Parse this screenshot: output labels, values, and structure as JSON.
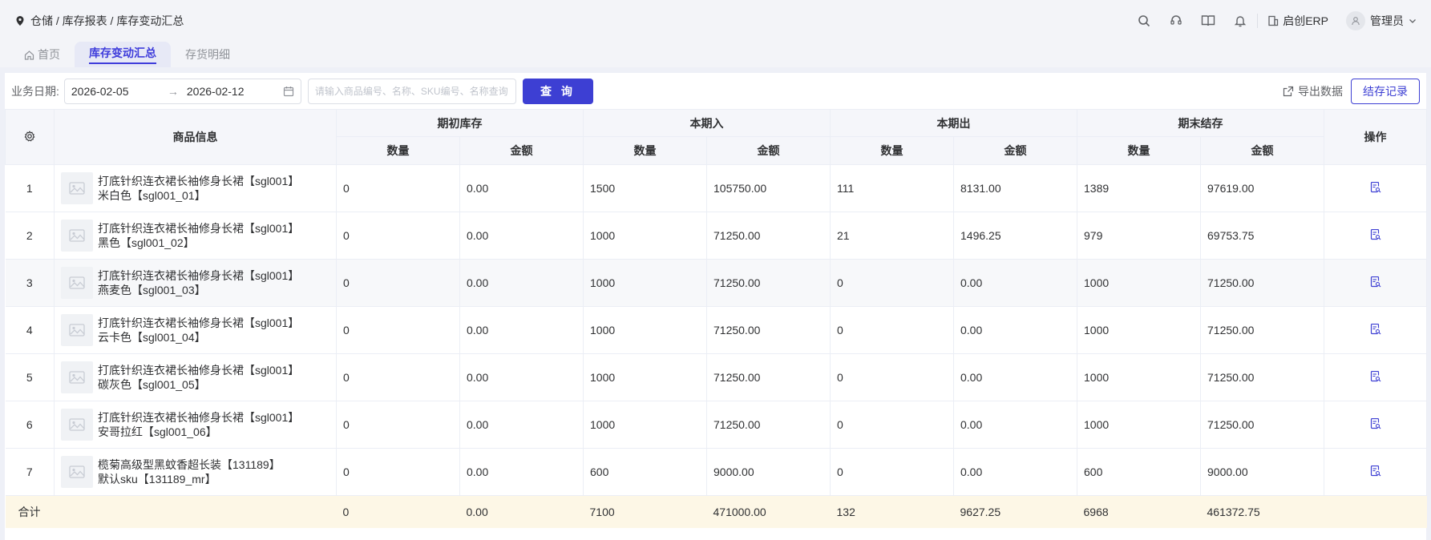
{
  "breadcrumb": {
    "icon": "location-pin-icon",
    "text": "仓储 / 库存报表 / 库存变动汇总"
  },
  "header": {
    "brand": "启创ERP",
    "user": "管理员"
  },
  "tabs": [
    {
      "label": "首页",
      "icon": "home-icon",
      "active": false
    },
    {
      "label": "库存变动汇总",
      "active": true
    },
    {
      "label": "存货明细",
      "active": false
    }
  ],
  "filter": {
    "date_label": "业务日期:",
    "start_date": "2026-02-05",
    "arrow": "→",
    "end_date": "2026-02-12",
    "search_placeholder": "请输入商品编号、名称、SKU编号、名称查询",
    "query_label": "查 询",
    "export_label": "导出数据",
    "close_label": "结存记录"
  },
  "table": {
    "header": {
      "product": "商品信息",
      "opening": "期初库存",
      "inbound": "本期入",
      "outbound": "本期出",
      "closing": "期末结存",
      "op": "操作",
      "qty": "数量",
      "amount": "金额"
    },
    "rows": [
      {
        "idx": "1",
        "name": "打底针织连衣裙长袖修身长裙【sgl001】",
        "sku": "米白色【sgl001_01】",
        "open_qty": "0",
        "open_amt": "0.00",
        "in_qty": "1500",
        "in_amt": "105750.00",
        "out_qty": "111",
        "out_amt": "8131.00",
        "close_qty": "1389",
        "close_amt": "97619.00"
      },
      {
        "idx": "2",
        "name": "打底针织连衣裙长袖修身长裙【sgl001】",
        "sku": "黑色【sgl001_02】",
        "open_qty": "0",
        "open_amt": "0.00",
        "in_qty": "1000",
        "in_amt": "71250.00",
        "out_qty": "21",
        "out_amt": "1496.25",
        "close_qty": "979",
        "close_amt": "69753.75"
      },
      {
        "idx": "3",
        "name": "打底针织连衣裙长袖修身长裙【sgl001】",
        "sku": "燕麦色【sgl001_03】",
        "open_qty": "0",
        "open_amt": "0.00",
        "in_qty": "1000",
        "in_amt": "71250.00",
        "out_qty": "0",
        "out_amt": "0.00",
        "close_qty": "1000",
        "close_amt": "71250.00"
      },
      {
        "idx": "4",
        "name": "打底针织连衣裙长袖修身长裙【sgl001】",
        "sku": "云卡色【sgl001_04】",
        "open_qty": "0",
        "open_amt": "0.00",
        "in_qty": "1000",
        "in_amt": "71250.00",
        "out_qty": "0",
        "out_amt": "0.00",
        "close_qty": "1000",
        "close_amt": "71250.00"
      },
      {
        "idx": "5",
        "name": "打底针织连衣裙长袖修身长裙【sgl001】",
        "sku": "碳灰色【sgl001_05】",
        "open_qty": "0",
        "open_amt": "0.00",
        "in_qty": "1000",
        "in_amt": "71250.00",
        "out_qty": "0",
        "out_amt": "0.00",
        "close_qty": "1000",
        "close_amt": "71250.00"
      },
      {
        "idx": "6",
        "name": "打底针织连衣裙长袖修身长裙【sgl001】",
        "sku": "安哥拉红【sgl001_06】",
        "open_qty": "0",
        "open_amt": "0.00",
        "in_qty": "1000",
        "in_amt": "71250.00",
        "out_qty": "0",
        "out_amt": "0.00",
        "close_qty": "1000",
        "close_amt": "71250.00"
      },
      {
        "idx": "7",
        "name": "榄菊高级型黑蚊香超长装【131189】",
        "sku": "默认sku【131189_mr】",
        "open_qty": "0",
        "open_amt": "0.00",
        "in_qty": "600",
        "in_amt": "9000.00",
        "out_qty": "0",
        "out_amt": "0.00",
        "close_qty": "600",
        "close_amt": "9000.00"
      }
    ],
    "total": {
      "label": "合计",
      "open_qty": "0",
      "open_amt": "0.00",
      "in_qty": "7100",
      "in_amt": "471000.00",
      "out_qty": "132",
      "out_amt": "9627.25",
      "close_qty": "6968",
      "close_amt": "461372.75"
    }
  },
  "colors": {
    "accent": "#3d3fd3",
    "total_row": "#fdf7e6",
    "header_bg": "#f5f6fa"
  }
}
